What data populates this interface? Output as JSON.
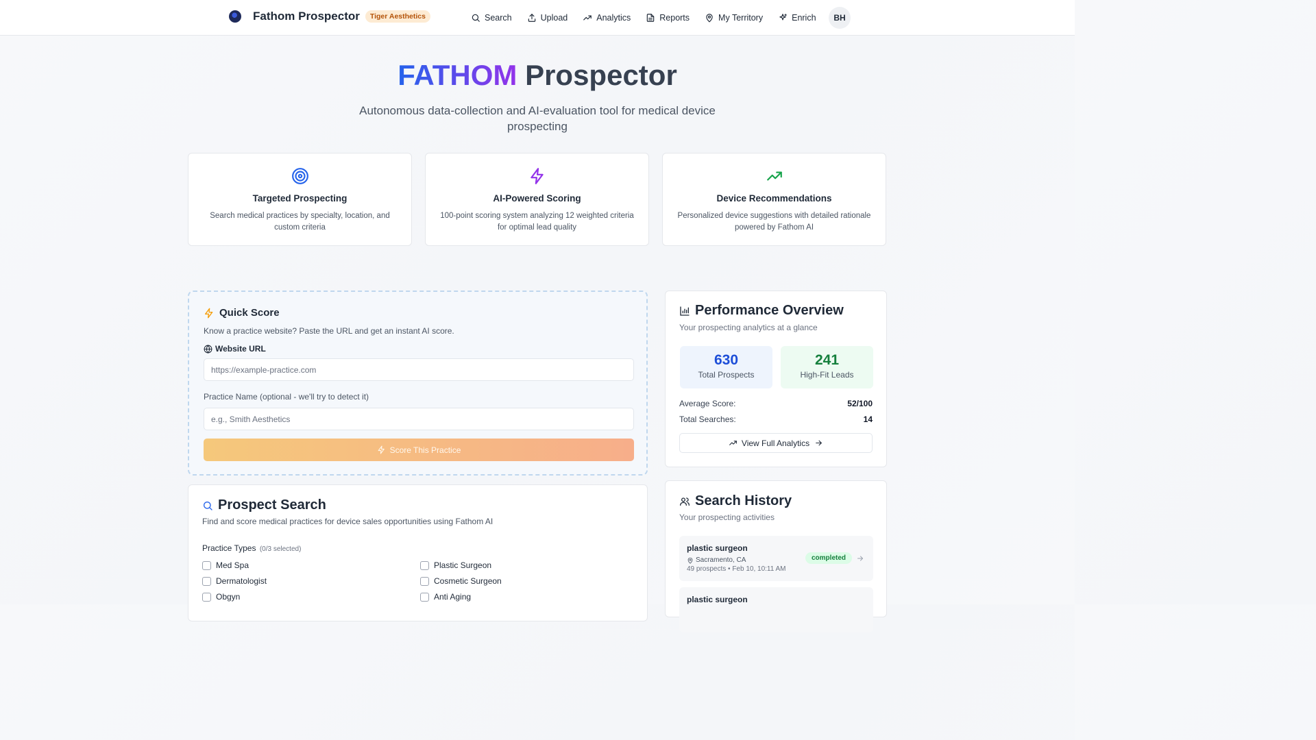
{
  "navbar": {
    "brand_name": "Fathom Prospector",
    "org_badge": "Tiger Aesthetics",
    "items": [
      {
        "label": "Search",
        "icon": "search-icon"
      },
      {
        "label": "Upload",
        "icon": "upload-icon"
      },
      {
        "label": "Analytics",
        "icon": "trending-up-icon"
      },
      {
        "label": "Reports",
        "icon": "file-text-icon"
      },
      {
        "label": "My Territory",
        "icon": "map-pin-icon"
      },
      {
        "label": "Enrich",
        "icon": "sparkles-icon"
      }
    ],
    "avatar_initials": "BH"
  },
  "hero": {
    "title_accent": "FATHOM",
    "title_rest": "Prospector",
    "subtitle": "Autonomous data-collection and AI-evaluation tool for medical device prospecting"
  },
  "features": [
    {
      "title": "Targeted Prospecting",
      "description": "Search medical practices by specialty, location, and custom criteria",
      "icon": "target-icon",
      "color": "#2563eb"
    },
    {
      "title": "AI-Powered Scoring",
      "description": "100-point scoring system analyzing 12 weighted criteria for optimal lead quality",
      "icon": "zap-icon",
      "color": "#9333ea"
    },
    {
      "title": "Device Recommendations",
      "description": "Personalized device suggestions with detailed rationale powered by Fathom AI",
      "icon": "trending-up-icon",
      "color": "#16a34a"
    }
  ],
  "quick_score": {
    "title": "Quick Score",
    "description": "Know a practice website? Paste the URL and get an instant AI score.",
    "url_label": "Website URL",
    "url_placeholder": "https://example-practice.com",
    "name_label": "Practice Name (optional - we'll try to detect it)",
    "name_placeholder": "e.g., Smith Aesthetics",
    "button_label": "Score This Practice"
  },
  "prospect_search": {
    "title": "Prospect Search",
    "description": "Find and score medical practices for device sales opportunities using Fathom AI",
    "practice_types_label": "Practice Types",
    "practice_types_selected": "(0/3 selected)",
    "options": [
      "Med Spa",
      "Plastic Surgeon",
      "Dermatologist",
      "Cosmetic Surgeon",
      "Obgyn",
      "Anti Aging"
    ]
  },
  "performance": {
    "title": "Performance Overview",
    "subtitle": "Your prospecting analytics at a glance",
    "total_prospects": "630",
    "total_prospects_label": "Total Prospects",
    "high_fit": "241",
    "high_fit_label": "High-Fit Leads",
    "avg_score_label": "Average Score:",
    "avg_score": "52/100",
    "total_searches_label": "Total Searches:",
    "total_searches": "14",
    "view_button": "View Full Analytics"
  },
  "history": {
    "title": "Search History",
    "subtitle": "Your prospecting activities",
    "items": [
      {
        "query": "plastic surgeon",
        "location": "Sacramento, CA",
        "meta": "49 prospects • Feb 10, 10:11 AM",
        "status": "completed"
      },
      {
        "query": "plastic surgeon"
      }
    ]
  }
}
